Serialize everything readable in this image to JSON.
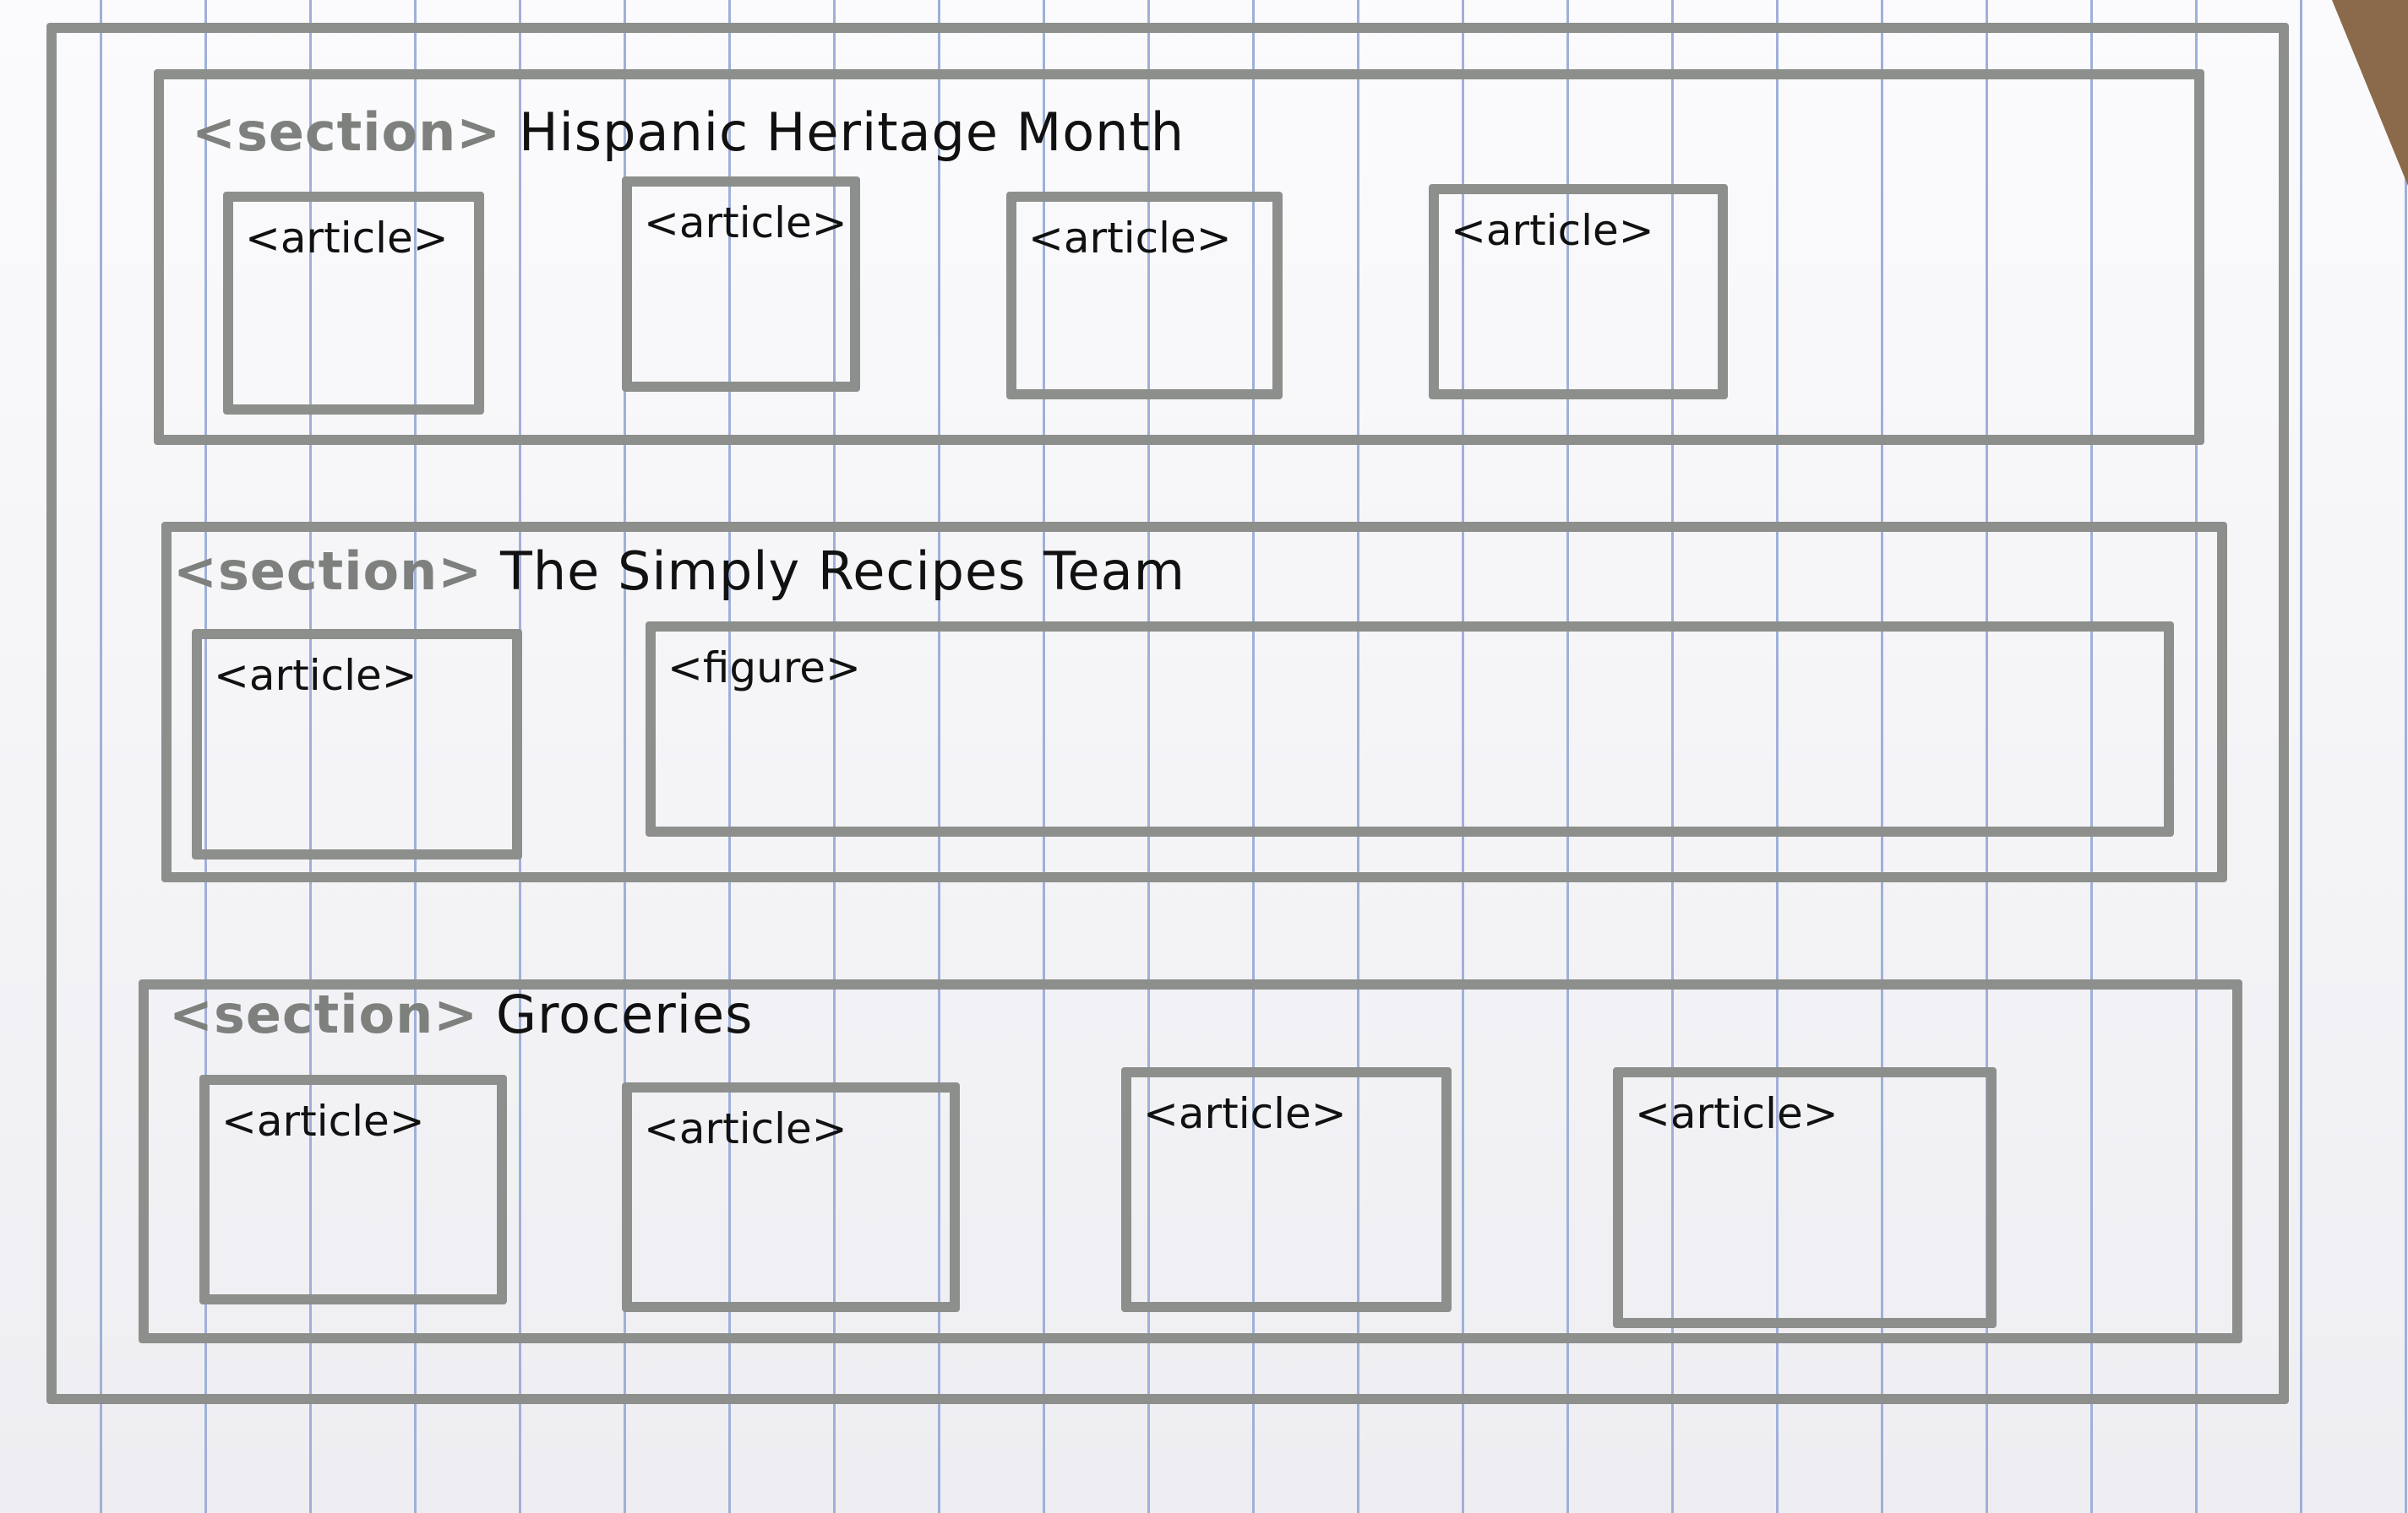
{
  "sections": [
    {
      "tag": "<section>",
      "title": "Hispanic Heritage Month",
      "children": [
        "<article>",
        "<article>",
        "<article>",
        "<article>"
      ]
    },
    {
      "tag": "<section>",
      "title": "The Simply Recipes Team",
      "children": [
        "<article>",
        "<figure>"
      ]
    },
    {
      "tag": "<section>",
      "title": "Groceries",
      "children": [
        "<article>",
        "<article>",
        "<article>",
        "<article>"
      ]
    }
  ],
  "colors": {
    "marker": "#8c8f8b",
    "ink": "#111111",
    "paper_lines": "#9fb0d8"
  }
}
